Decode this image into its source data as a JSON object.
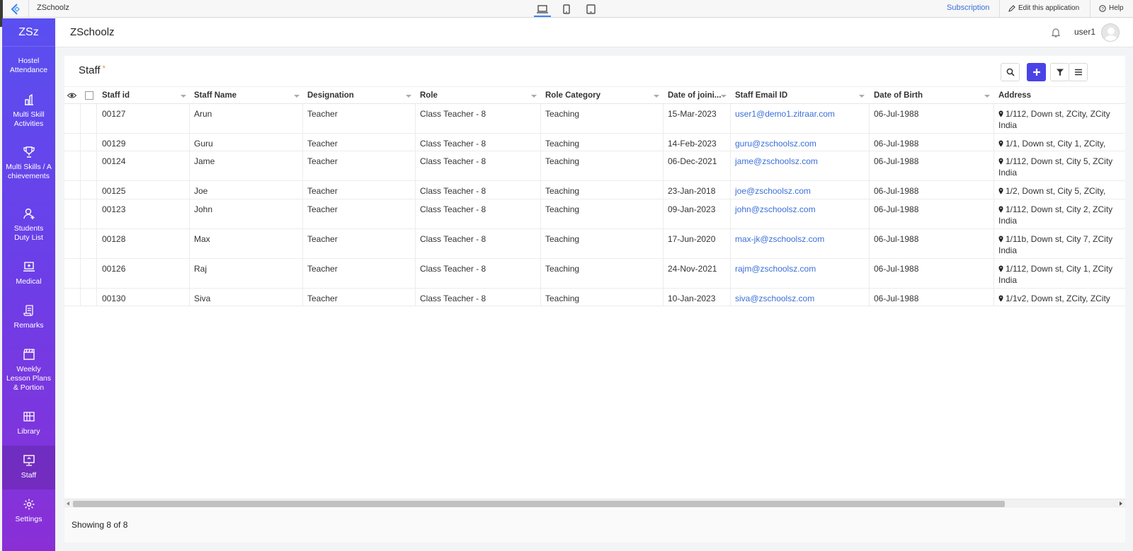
{
  "topbar": {
    "app_name": "ZSchoolz",
    "subscription": "Subscription",
    "edit_app": "Edit this application",
    "help": "Help",
    "devices": [
      "laptop-icon",
      "phone-icon",
      "tablet-icon"
    ],
    "active_device": "laptop-icon"
  },
  "sidebar": {
    "brand": "ZSz",
    "items": [
      {
        "label": "Hostel Attendance",
        "icon": "none",
        "active": false
      },
      {
        "label": "Multi Skill Activities",
        "icon": "activity-icon",
        "active": false
      },
      {
        "label": "Multi Skills / Achievements",
        "icon": "trophy-icon",
        "active": false
      },
      {
        "label": "Students Duty List",
        "icon": "user-add-icon",
        "active": false
      },
      {
        "label": "Medical",
        "icon": "medical-laptop-icon",
        "active": false
      },
      {
        "label": "Remarks",
        "icon": "scroll-icon",
        "active": false
      },
      {
        "label": "Weekly Lesson Plans & Portion",
        "icon": "clapperboard-icon",
        "active": false
      },
      {
        "label": "Library",
        "icon": "books-icon",
        "active": false
      },
      {
        "label": "Staff",
        "icon": "monitor-icon",
        "active": true
      },
      {
        "label": "Settings",
        "icon": "gear-icon",
        "active": false
      }
    ]
  },
  "header": {
    "title": "ZSchoolz",
    "user": "user1"
  },
  "page": {
    "title": "Staff",
    "required_marker": "*",
    "showing": "Showing 8 of 8"
  },
  "table": {
    "columns": [
      "Staff id",
      "Staff Name",
      "Designation",
      "Role",
      "Role Category",
      "Date of joini...",
      "Staff Email ID",
      "Date of Birth",
      "Address"
    ],
    "rows": [
      {
        "id": "00127",
        "name": "Arun",
        "designation": "Teacher",
        "role": "Class Teacher - 8",
        "category": "Teaching",
        "joined": "15-Mar-2023",
        "email": "user1@demo1.zitraar.com",
        "dob": "06-Jul-1988",
        "address": "1/112, Down st, ZCity, ZCity India"
      },
      {
        "id": "00129",
        "name": "Guru",
        "designation": "Teacher",
        "role": "Class Teacher - 8",
        "category": "Teaching",
        "joined": "14-Feb-2023",
        "email": "guru@zschoolsz.com",
        "dob": "06-Jul-1988",
        "address": "1/1, Down st, City 1, ZCity,"
      },
      {
        "id": "00124",
        "name": "Jame",
        "designation": "Teacher",
        "role": "Class Teacher - 8",
        "category": "Teaching",
        "joined": "06-Dec-2021",
        "email": "jame@zschoolsz.com",
        "dob": "06-Jul-1988",
        "address": "1/112, Down st, City 5, ZCity India"
      },
      {
        "id": "00125",
        "name": "Joe",
        "designation": "Teacher",
        "role": "Class Teacher - 8",
        "category": "Teaching",
        "joined": "23-Jan-2018",
        "email": "joe@zschoolsz.com",
        "dob": "06-Jul-1988",
        "address": "1/2, Down st, City 5, ZCity,"
      },
      {
        "id": "00123",
        "name": "John",
        "designation": "Teacher",
        "role": "Class Teacher - 8",
        "category": "Teaching",
        "joined": "09-Jan-2023",
        "email": "john@zschoolsz.com",
        "dob": "06-Jul-1988",
        "address": "1/112, Down st, City 2, ZCity India"
      },
      {
        "id": "00128",
        "name": "Max",
        "designation": "Teacher",
        "role": "Class Teacher - 8",
        "category": "Teaching",
        "joined": "17-Jun-2020",
        "email": "max-jk@zschoolsz.com",
        "dob": "06-Jul-1988",
        "address": "1/11b, Down st, City 7, ZCity India"
      },
      {
        "id": "00126",
        "name": "Raj",
        "designation": "Teacher",
        "role": "Class Teacher - 8",
        "category": "Teaching",
        "joined": "24-Nov-2021",
        "email": "rajm@zschoolsz.com",
        "dob": "06-Jul-1988",
        "address": "1/112, Down st, City 1, ZCity India"
      },
      {
        "id": "00130",
        "name": "Siva",
        "designation": "Teacher",
        "role": "Class Teacher - 8",
        "category": "Teaching",
        "joined": "10-Jan-2023",
        "email": "siva@zschoolsz.com",
        "dob": "06-Jul-1988",
        "address": "1/1v2, Down st, ZCity, ZCity"
      }
    ]
  },
  "colors": {
    "accent": "#4a43e6",
    "link": "#3b6fd8",
    "sidebar_top": "#5a4ff0",
    "sidebar_bottom": "#8a2fd6"
  }
}
